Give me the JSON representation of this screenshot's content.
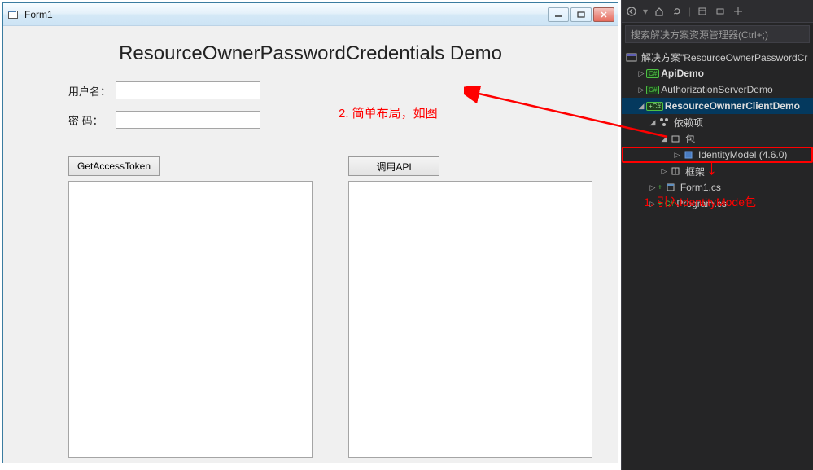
{
  "winform": {
    "title": "Form1",
    "heading": "ResourceOwnerPasswordCredentials Demo",
    "labels": {
      "username": "用户名：",
      "password": "密  码："
    },
    "buttons": {
      "getToken": "GetAccessToken",
      "callApi": "调用API"
    }
  },
  "annotations": {
    "a1": "1. 引入IdentityMode包",
    "a2": "2. 简单布局，如图"
  },
  "vs": {
    "searchPlaceholder": "搜索解决方案资源管理器(Ctrl+;)",
    "solution": "解决方案\"ResourceOwnerPasswordCr",
    "nodes": {
      "apiDemo": "ApiDemo",
      "authServer": "AuthorizationServerDemo",
      "clientDemo": "ResourceOwnnerClientDemo",
      "deps": "依赖项",
      "packages": "包",
      "identityModel": "IdentityModel (4.6.0)",
      "frameworks": "框架",
      "form1": "Form1.cs",
      "program": "Program.cs"
    }
  }
}
